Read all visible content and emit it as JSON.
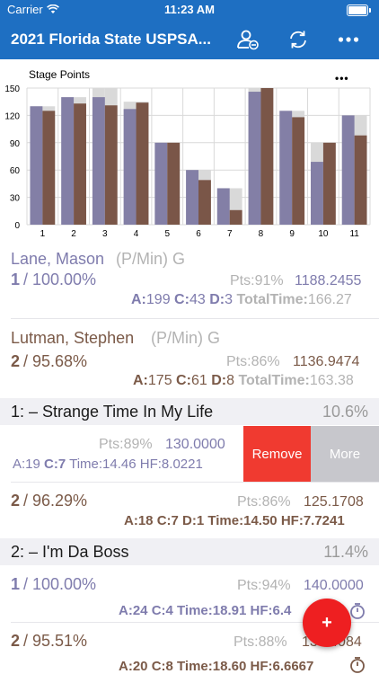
{
  "status": {
    "carrier": "Carrier",
    "time": "11:23 AM"
  },
  "nav": {
    "title": "2021 Florida State USPSA..."
  },
  "chart_data": {
    "type": "bar",
    "title": "Stage Points",
    "categories": [
      "1",
      "2",
      "3",
      "4",
      "5",
      "6",
      "7",
      "8",
      "9",
      "10",
      "11"
    ],
    "ylim": [
      0,
      150
    ],
    "yticks": [
      "0",
      "30",
      "60",
      "90",
      "120",
      "150"
    ],
    "max_values": [
      130,
      140,
      150,
      135,
      90,
      60,
      40,
      150,
      125,
      90,
      120
    ],
    "series": [
      {
        "values": [
          130,
          140,
          140,
          127,
          90,
          60,
          40,
          146,
          125,
          69,
          120
        ],
        "color": "#837fa6"
      },
      {
        "values": [
          125,
          133,
          131,
          134,
          90,
          49,
          16,
          150,
          118,
          90,
          98
        ],
        "color": "#7a5648"
      }
    ],
    "colors": {
      "max": "#d9d9d9",
      "grid": "#d9d9d9"
    }
  },
  "shooter1": {
    "name": "Lane, Mason",
    "division": "(P/Min) G",
    "place": "1",
    "pct": "/ 100.00%",
    "pts": "Pts:91%",
    "score": "1188.2455",
    "a_label": "A:",
    "a_value": "199",
    "c_label": "C:",
    "c_value": "43",
    "d_label": "D:",
    "d_value": "3",
    "time_label": "TotalTime:",
    "time_value": "166.27"
  },
  "shooter2": {
    "name": "Lutman, Stephen",
    "division": "(P/Min) G",
    "place": "2",
    "pct": "/ 95.68%",
    "pts": "Pts:86%",
    "score": "1136.9474",
    "a_label": "A:",
    "a_value": "175",
    "c_label": "C:",
    "c_value": "61",
    "d_label": "D:",
    "d_value": "8",
    "time_label": "TotalTime:",
    "time_value": "163.38"
  },
  "stage1": {
    "name": "1: – Strange Time In My Life",
    "pct": "10.6%",
    "row1": {
      "pts": "Pts:89%",
      "score": "130.0000",
      "a": "A:19",
      "c": "C:7",
      "time": "Time:14.46",
      "hf": "HF:8.0221"
    },
    "row2": {
      "place": "2",
      "pct": "/ 96.29%",
      "pts": "Pts:86%",
      "score": "125.1708",
      "a": "A:18",
      "c": "C:7",
      "d": "D:1",
      "time": "Time:14.50",
      "hf": "HF:7.7241"
    }
  },
  "swipe": {
    "remove": "Remove",
    "more": "More"
  },
  "stage2": {
    "name": "2: – I'm Da Boss",
    "pct": "11.4%",
    "row1": {
      "place": "1",
      "pct": "/ 100.00%",
      "pts": "Pts:94%",
      "score": "140.0000",
      "a": "A:24",
      "c": "C:4",
      "time": "Time:18.91",
      "hf": "HF:6.4"
    },
    "row2": {
      "place": "2",
      "pct": "/ 95.51%",
      "pts": "Pts:88%",
      "score": "13€.4084",
      "a": "A:20",
      "c": "C:8",
      "time": "Time:18.60",
      "hf": "HF:6.6667"
    }
  },
  "fab": {
    "label": "+"
  },
  "icons": {
    "user": "user-switch-icon",
    "refresh": "refresh-icon",
    "more": "more-icon",
    "timer": "stopwatch-icon"
  }
}
